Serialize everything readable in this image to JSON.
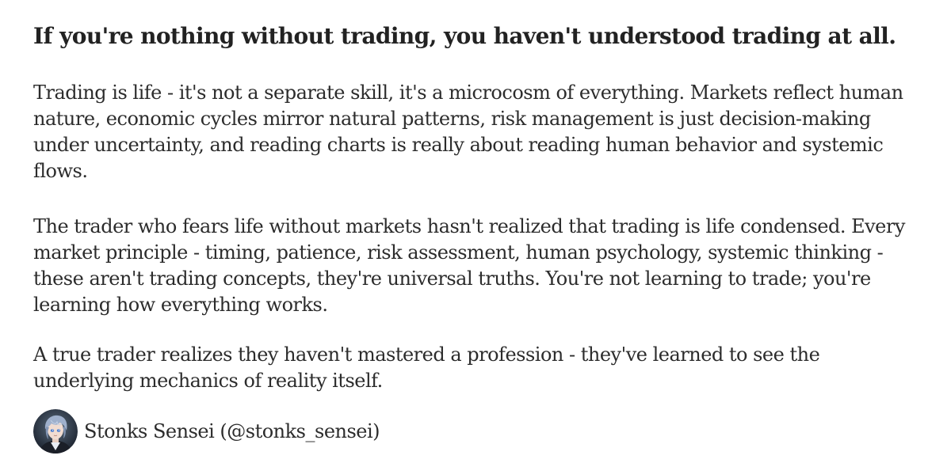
{
  "post": {
    "title": "If you're nothing without trading, you haven't understood trading at all.",
    "paragraphs": [
      "Trading is life - it's not a separate skill, it's a microcosm of everything. Markets reflect human nature, economic cycles mirror natural patterns, risk management is just decision-making under uncertainty, and reading charts is really about reading human behavior and systemic flows.",
      "The trader who fears life without markets hasn't realized that trading is life condensed. Every market principle - timing, patience, risk assessment, human psychology, systemic thinking - these aren't trading concepts, they're universal truths. You're not learning to trade; you're learning how everything works.",
      "A true trader realizes they haven't mastered a profession - they've learned to see the underlying mechanics of reality itself."
    ]
  },
  "author": {
    "display": "Stonks Sensei (@stonks_sensei)",
    "avatar_icon": "anime-avatar-icon"
  },
  "colors": {
    "text": "#2c2c2c",
    "title": "#222222",
    "background": "#ffffff"
  }
}
